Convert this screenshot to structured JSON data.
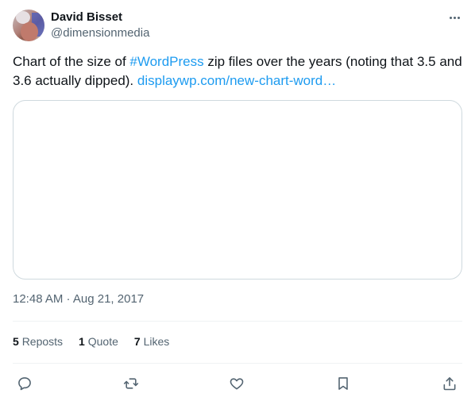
{
  "author": {
    "display_name": "David Bisset",
    "handle": "@dimensionmedia"
  },
  "tweet": {
    "text_before": "Chart of the size of ",
    "hashtag": "#WordPress",
    "text_after": " zip files over the years (noting that 3.5 and 3.6 actually dipped). ",
    "link": "displaywp.com/new-chart-word…",
    "timestamp": "12:48 AM · Aug 21, 2017"
  },
  "stats": {
    "reposts_count": "5",
    "reposts_label": "Reposts",
    "quotes_count": "1",
    "quotes_label": "Quote",
    "likes_count": "7",
    "likes_label": "Likes"
  },
  "icons": {
    "more": "more-horizontal-icon",
    "reply": "reply-icon",
    "repost": "repost-icon",
    "like": "heart-icon",
    "bookmark": "bookmark-icon",
    "share": "share-icon"
  },
  "colors": {
    "link": "#1d9bf0",
    "secondary_text": "#536471",
    "primary_text": "#0f1419",
    "border": "#cfd9de"
  }
}
